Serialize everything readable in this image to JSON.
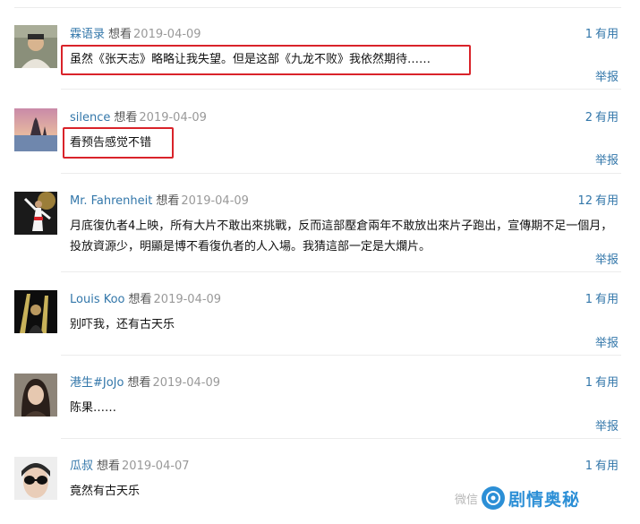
{
  "comments": [
    {
      "user": "霖语录",
      "status": "想看",
      "date": "2019-04-09",
      "votes": "1",
      "votes_label": "有用",
      "text": "虽然《张天志》略略让我失望。但是这部《九龙不败》我依然期待……",
      "report": "举报"
    },
    {
      "user": "silence",
      "status": "想看",
      "date": "2019-04-09",
      "votes": "2",
      "votes_label": "有用",
      "text": "看预告感觉不错",
      "report": "举报"
    },
    {
      "user": "Mr. Fahrenheit",
      "status": "想看",
      "date": "2019-04-09",
      "votes": "12",
      "votes_label": "有用",
      "text": "月底復仇者4上映，所有大片不敢出來挑戰，反而這部壓倉兩年不敢放出來片子跑出，宣傳期不足一個月，投放資源少，明顯是博不看復仇者的人入場。我猜這部一定是大爛片。",
      "report": "举报"
    },
    {
      "user": "Louis Koo",
      "status": "想看",
      "date": "2019-04-09",
      "votes": "1",
      "votes_label": "有用",
      "text": "别吓我，还有古天乐",
      "report": "举报"
    },
    {
      "user": "港生#JoJo",
      "status": "想看",
      "date": "2019-04-09",
      "votes": "1",
      "votes_label": "有用",
      "text": "陈果……",
      "report": "举报"
    },
    {
      "user": "瓜叔",
      "status": "想看",
      "date": "2019-04-07",
      "votes": "1",
      "votes_label": "有用",
      "text": "竟然有古天乐",
      "report": ""
    }
  ],
  "watermark": {
    "prefix": "微信",
    "brand": "剧情奥秘"
  },
  "colors": {
    "link": "#3377aa",
    "date": "#999999",
    "highlight": "#d9232a",
    "brand": "#2c8fd6"
  }
}
